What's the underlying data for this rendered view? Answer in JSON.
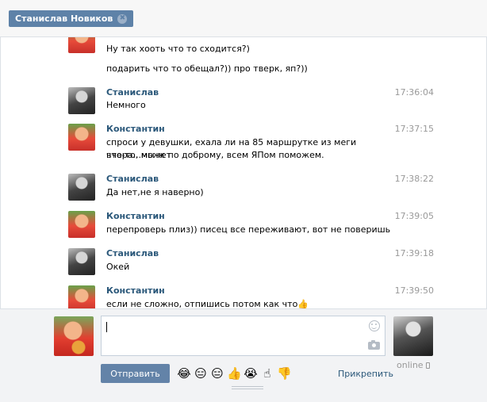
{
  "tab": {
    "title": "Станислав Новиков",
    "close_glyph": "✖"
  },
  "messages": [
    {
      "id": "m1",
      "avatar": "konstantin",
      "author": "",
      "time": "",
      "lines": [
        "Ну так хоoть что то сходится?)"
      ]
    },
    {
      "id": "m2",
      "avatar": "",
      "author": "",
      "time": "",
      "lines": [
        "подарить что то обещал?)) про тверк, яп?))"
      ]
    },
    {
      "id": "m3",
      "avatar": "stanislav",
      "author": "Станислав",
      "time": "17:36:04",
      "lines": [
        "Немного"
      ]
    },
    {
      "id": "m4",
      "avatar": "konstantin",
      "author": "Константин",
      "time": "17:37:15",
      "lines": [
        "спроси у девушки, ехала ли на 85 маршрутке из меги вчера...может",
        "что-то, мы ж по доброму, всем ЯПом поможем."
      ]
    },
    {
      "id": "m5",
      "avatar": "stanislav",
      "author": "Станислав",
      "time": "17:38:22",
      "lines": [
        "Да нет,не я наверно)"
      ]
    },
    {
      "id": "m6",
      "avatar": "konstantin",
      "author": "Константин",
      "time": "17:39:05",
      "lines": [
        "перепроверь плиз)) писец все переживают, вот не поверишь"
      ]
    },
    {
      "id": "m7",
      "avatar": "stanislav",
      "author": "Станислав",
      "time": "17:39:18",
      "lines": [
        "Окей"
      ]
    },
    {
      "id": "m8",
      "avatar": "konstantin",
      "author": "Константин",
      "time": "17:39:50",
      "lines": [
        "если не сложно, отпишись потом как что👍"
      ]
    }
  ],
  "composer": {
    "input_value": "",
    "send_label": "Отправить",
    "attach_label": "Прикрепить",
    "emojis": [
      "😂",
      "😑",
      "😑",
      "👍",
      "😭",
      "☝",
      "👎"
    ],
    "peer_status": "online",
    "icons": {
      "smile": "smile-icon",
      "camera": "camera-icon",
      "phone": "phone-icon"
    }
  }
}
